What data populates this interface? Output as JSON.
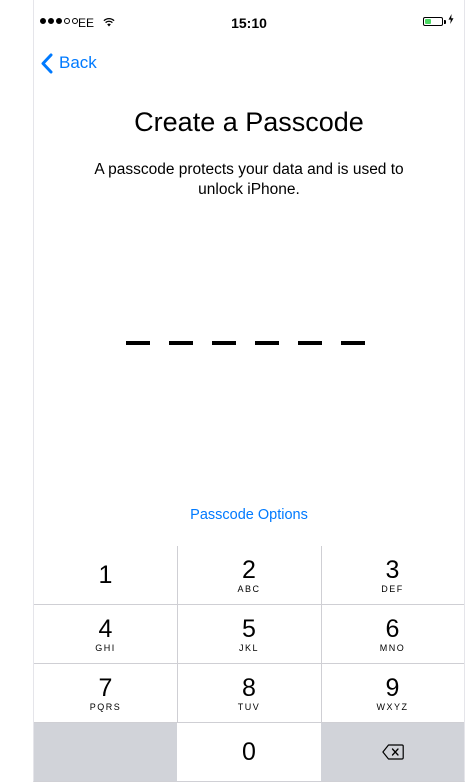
{
  "status_bar": {
    "carrier": "EE",
    "time": "15:10",
    "signal_strength": 3,
    "signal_max": 5,
    "battery_level": 0.4,
    "battery_color": "#4cd964",
    "icons": [
      "wifi-icon",
      "battery-icon",
      "charging-icon"
    ]
  },
  "nav": {
    "back_label": "Back",
    "accent_color": "#007aff"
  },
  "main": {
    "title": "Create a Passcode",
    "subtitle_line1": "A passcode protects your data and is used to",
    "subtitle_line2": "unlock iPhone.",
    "passcode_length": 6,
    "options_label": "Passcode Options"
  },
  "keypad": {
    "keys": [
      {
        "digit": "1",
        "letters": ""
      },
      {
        "digit": "2",
        "letters": "ABC"
      },
      {
        "digit": "3",
        "letters": "DEF"
      },
      {
        "digit": "4",
        "letters": "GHI"
      },
      {
        "digit": "5",
        "letters": "JKL"
      },
      {
        "digit": "6",
        "letters": "MNO"
      },
      {
        "digit": "7",
        "letters": "PQRS"
      },
      {
        "digit": "8",
        "letters": "TUV"
      },
      {
        "digit": "9",
        "letters": "WXYZ"
      },
      {
        "digit": "0",
        "letters": ""
      }
    ],
    "delete_icon": "delete-backspace-icon"
  }
}
